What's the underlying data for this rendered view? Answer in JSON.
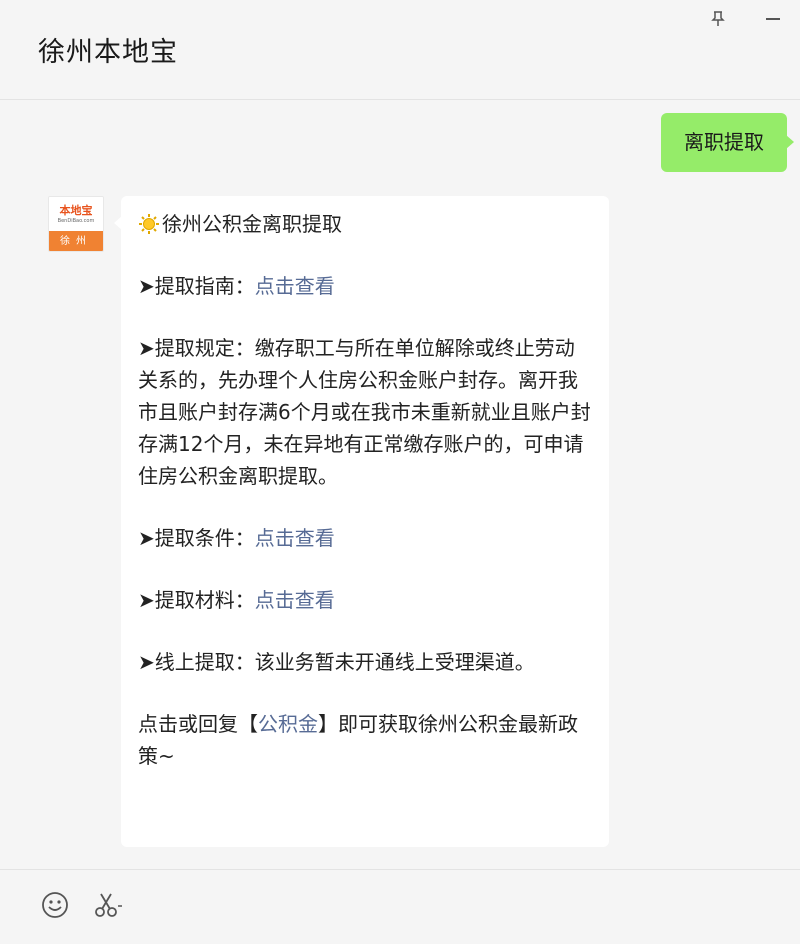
{
  "window": {
    "title": "徐州本地宝",
    "pin_icon": "pin-icon",
    "minimize_icon": "minimize-icon"
  },
  "messages": {
    "outgoing": {
      "text": "离职提取",
      "color": "#95ec69"
    },
    "incoming": {
      "avatar": {
        "brand": "本地宝",
        "sub": "BenDiBao.com",
        "city": "徐州",
        "accent": "#f08232"
      },
      "title_icon": "sun-icon",
      "title": "徐州公积金离职提取",
      "guide": {
        "prefix": "➤提取指南：",
        "link": "点击查看"
      },
      "rules": {
        "prefix": "➤提取规定：",
        "text": "缴存职工与所在单位解除或终止劳动关系的，先办理个人住房公积金账户封存。离开我市且账户封存满6个月或在我市未重新就业且账户封存满12个月，未在异地有正常缴存账户的，可申请住房公积金离职提取。"
      },
      "conditions": {
        "prefix": "➤提取条件：",
        "link": "点击查看"
      },
      "materials": {
        "prefix": "➤提取材料：",
        "link": "点击查看"
      },
      "online": {
        "prefix": "➤线上提取：",
        "text": "该业务暂未开通线上受理渠道。"
      },
      "footer": {
        "before": "点击或回复【",
        "link": "公积金",
        "after": "】即可获取徐州公积金最新政策~"
      },
      "link_color": "#576b95"
    }
  },
  "toolbar": {
    "emoji_icon": "smile-icon",
    "screenshot_icon": "scissors-icon"
  }
}
